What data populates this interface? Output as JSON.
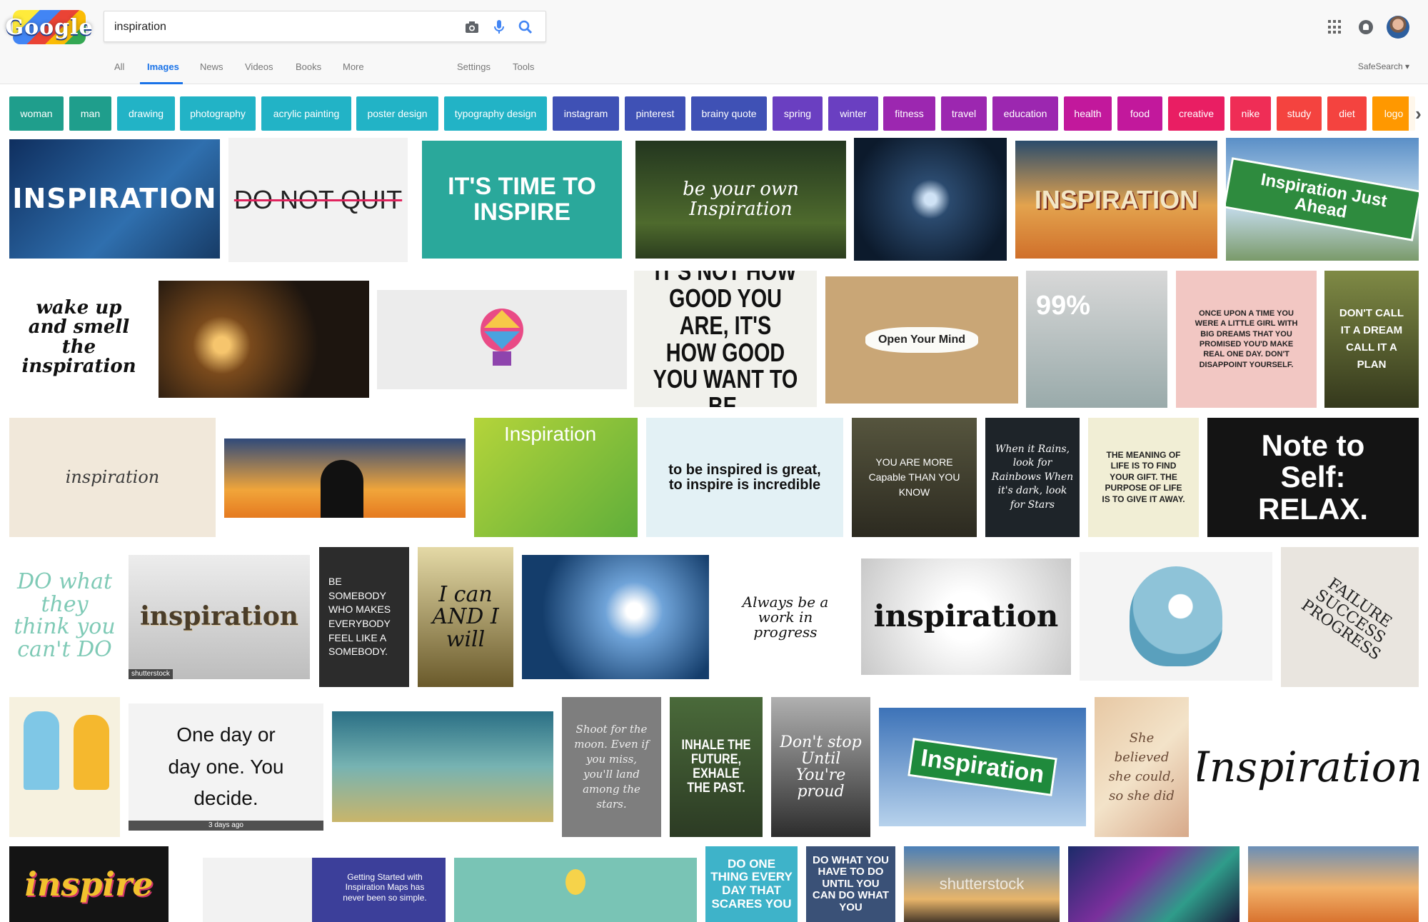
{
  "header": {
    "logo_text": "Google",
    "query": "inspiration",
    "icons": [
      "camera-icon",
      "microphone-icon",
      "search-icon",
      "apps-icon",
      "notifications-icon",
      "avatar"
    ],
    "tabs": [
      {
        "label": "All",
        "active": false
      },
      {
        "label": "Images",
        "active": true
      },
      {
        "label": "News",
        "active": false
      },
      {
        "label": "Videos",
        "active": false
      },
      {
        "label": "Books",
        "active": false
      },
      {
        "label": "More",
        "active": false
      }
    ],
    "settings_label": "Settings",
    "tools_label": "Tools",
    "safesearch_label": "SafeSearch ▾"
  },
  "chips": [
    {
      "label": "woman",
      "color": "#1f9e8c"
    },
    {
      "label": "man",
      "color": "#1f9e8c"
    },
    {
      "label": "drawing",
      "color": "#22b3c6"
    },
    {
      "label": "photography",
      "color": "#22b3c6"
    },
    {
      "label": "acrylic painting",
      "color": "#22b3c6"
    },
    {
      "label": "poster design",
      "color": "#22b3c6"
    },
    {
      "label": "typography design",
      "color": "#22b3c6"
    },
    {
      "label": "instagram",
      "color": "#3f51b5"
    },
    {
      "label": "pinterest",
      "color": "#3f51b5"
    },
    {
      "label": "brainy quote",
      "color": "#3f51b5"
    },
    {
      "label": "spring",
      "color": "#6a3fc1"
    },
    {
      "label": "winter",
      "color": "#6a3fc1"
    },
    {
      "label": "fitness",
      "color": "#9c27b0"
    },
    {
      "label": "travel",
      "color": "#9c27b0"
    },
    {
      "label": "education",
      "color": "#9c27b0"
    },
    {
      "label": "health",
      "color": "#c2189c"
    },
    {
      "label": "food",
      "color": "#c2189c"
    },
    {
      "label": "creative",
      "color": "#e91e63"
    },
    {
      "label": "nike",
      "color": "#ef2d56"
    },
    {
      "label": "study",
      "color": "#f4433f"
    },
    {
      "label": "diet",
      "color": "#f4433f"
    },
    {
      "label": "logo",
      "color": "#ff9800"
    }
  ],
  "images": {
    "r1": [
      "INSPIRATION",
      "DO NOT QUIT",
      "IT'S TIME TO INSPIRE",
      "be your own Inspiration",
      "",
      "INSPIRATION",
      "Inspiration Just Ahead"
    ],
    "r2": [
      "wake up and smell the inspiration",
      "",
      "",
      "IT'S NOT HOW GOOD YOU ARE, IT'S HOW GOOD YOU WANT TO BE.",
      "Open Your Mind",
      "99%",
      "ONCE UPON A TIME YOU WERE A LITTLE GIRL WITH BIG DREAMS THAT YOU PROMISED YOU'D MAKE REAL ONE DAY. DON'T DISAPPOINT YOURSELF.",
      "DON'T CALL IT A DREAM CALL IT A PLAN"
    ],
    "r3": [
      "inspiration",
      "",
      "Inspiration",
      "to be inspired is great, to inspire is incredible",
      "YOU ARE MORE Capable THAN YOU KNOW",
      "When it Rains, look for Rainbows When it's dark, look for Stars",
      "THE MEANING OF LIFE IS TO FIND YOUR GIFT. THE PURPOSE OF LIFE IS TO GIVE IT AWAY.",
      "Note to Self: RELAX."
    ],
    "r4": [
      "DO what they think you can't DO",
      "inspiration",
      "BE SOMEBODY WHO MAKES EVERYBODY FEEL LIKE A SOMEBODY.",
      "I can AND I will",
      "",
      "Always be a work in progress",
      "inspiration",
      "",
      "FAILURE SUCCESS PROGRESS"
    ],
    "r5": [
      "",
      "One day or day one. You decide.",
      "",
      "Shoot for the moon. Even if you miss, you'll land among the stars.",
      "INHALE THE FUTURE, EXHALE THE PAST.",
      "Don't stop Until You're proud",
      "Inspiration",
      "She believed she could, so she did",
      "Inspiration"
    ],
    "r6": [
      "inspire",
      "Getting Started with Inspiration Maps has never been so simple.",
      "",
      "DO ONE THING EVERY DAY THAT SCARES YOU",
      "DO WHAT YOU HAVE TO DO UNTIL YOU CAN DO WHAT YOU",
      "shutterstock",
      "",
      ""
    ],
    "badges": {
      "stock": "shutterstock",
      "days": "3 days ago"
    }
  }
}
